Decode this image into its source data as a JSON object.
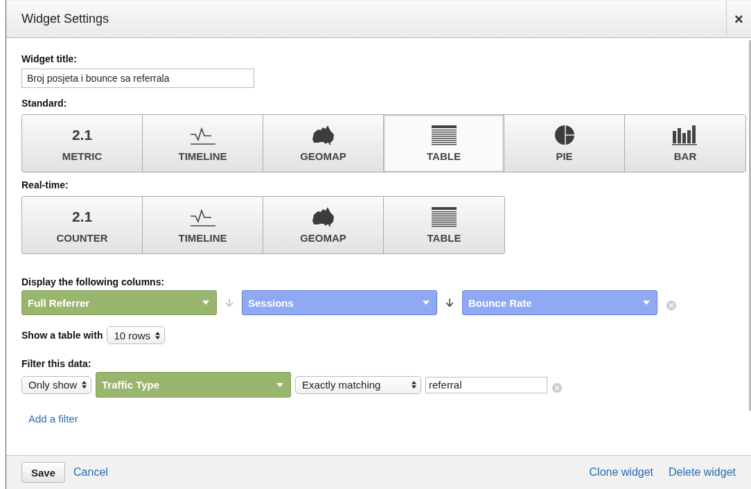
{
  "window": {
    "title": "Widget Settings",
    "close": "×"
  },
  "widget_title": {
    "label": "Widget title:",
    "value": "Broj posjeta i bounce sa referrala"
  },
  "standard": {
    "label": "Standard:",
    "types": [
      {
        "kind": "metric",
        "glyph": "2.1",
        "label": "METRIC",
        "selected": false
      },
      {
        "kind": "timeline",
        "label": "TIMELINE",
        "selected": false
      },
      {
        "kind": "geomap",
        "label": "GEOMAP",
        "selected": false
      },
      {
        "kind": "table",
        "label": "TABLE",
        "selected": true
      },
      {
        "kind": "pie",
        "label": "PIE",
        "selected": false
      },
      {
        "kind": "bar",
        "label": "BAR",
        "selected": false
      }
    ]
  },
  "realtime": {
    "label": "Real-time:",
    "types": [
      {
        "kind": "metric",
        "glyph": "2.1",
        "label": "COUNTER",
        "selected": false
      },
      {
        "kind": "timeline",
        "label": "TIMELINE",
        "selected": false
      },
      {
        "kind": "geomap",
        "label": "GEOMAP",
        "selected": false
      },
      {
        "kind": "table",
        "label": "TABLE",
        "selected": false
      }
    ]
  },
  "columns": {
    "label": "Display the following columns:",
    "items": [
      {
        "kind": "dimension",
        "value": "Full Referrer",
        "sort_active": false
      },
      {
        "kind": "metric",
        "value": "Sessions",
        "sort_active": true
      },
      {
        "kind": "metric",
        "value": "Bounce Rate"
      }
    ]
  },
  "rows": {
    "label": "Show a table with",
    "value": "10 rows"
  },
  "filter": {
    "label": "Filter this data:",
    "mode": "Only show",
    "dimension": "Traffic Type",
    "match": "Exactly matching",
    "value": "referral",
    "add_link": "Add a filter"
  },
  "footer": {
    "save": "Save",
    "cancel": "Cancel",
    "clone": "Clone widget",
    "delete": "Delete widget"
  }
}
